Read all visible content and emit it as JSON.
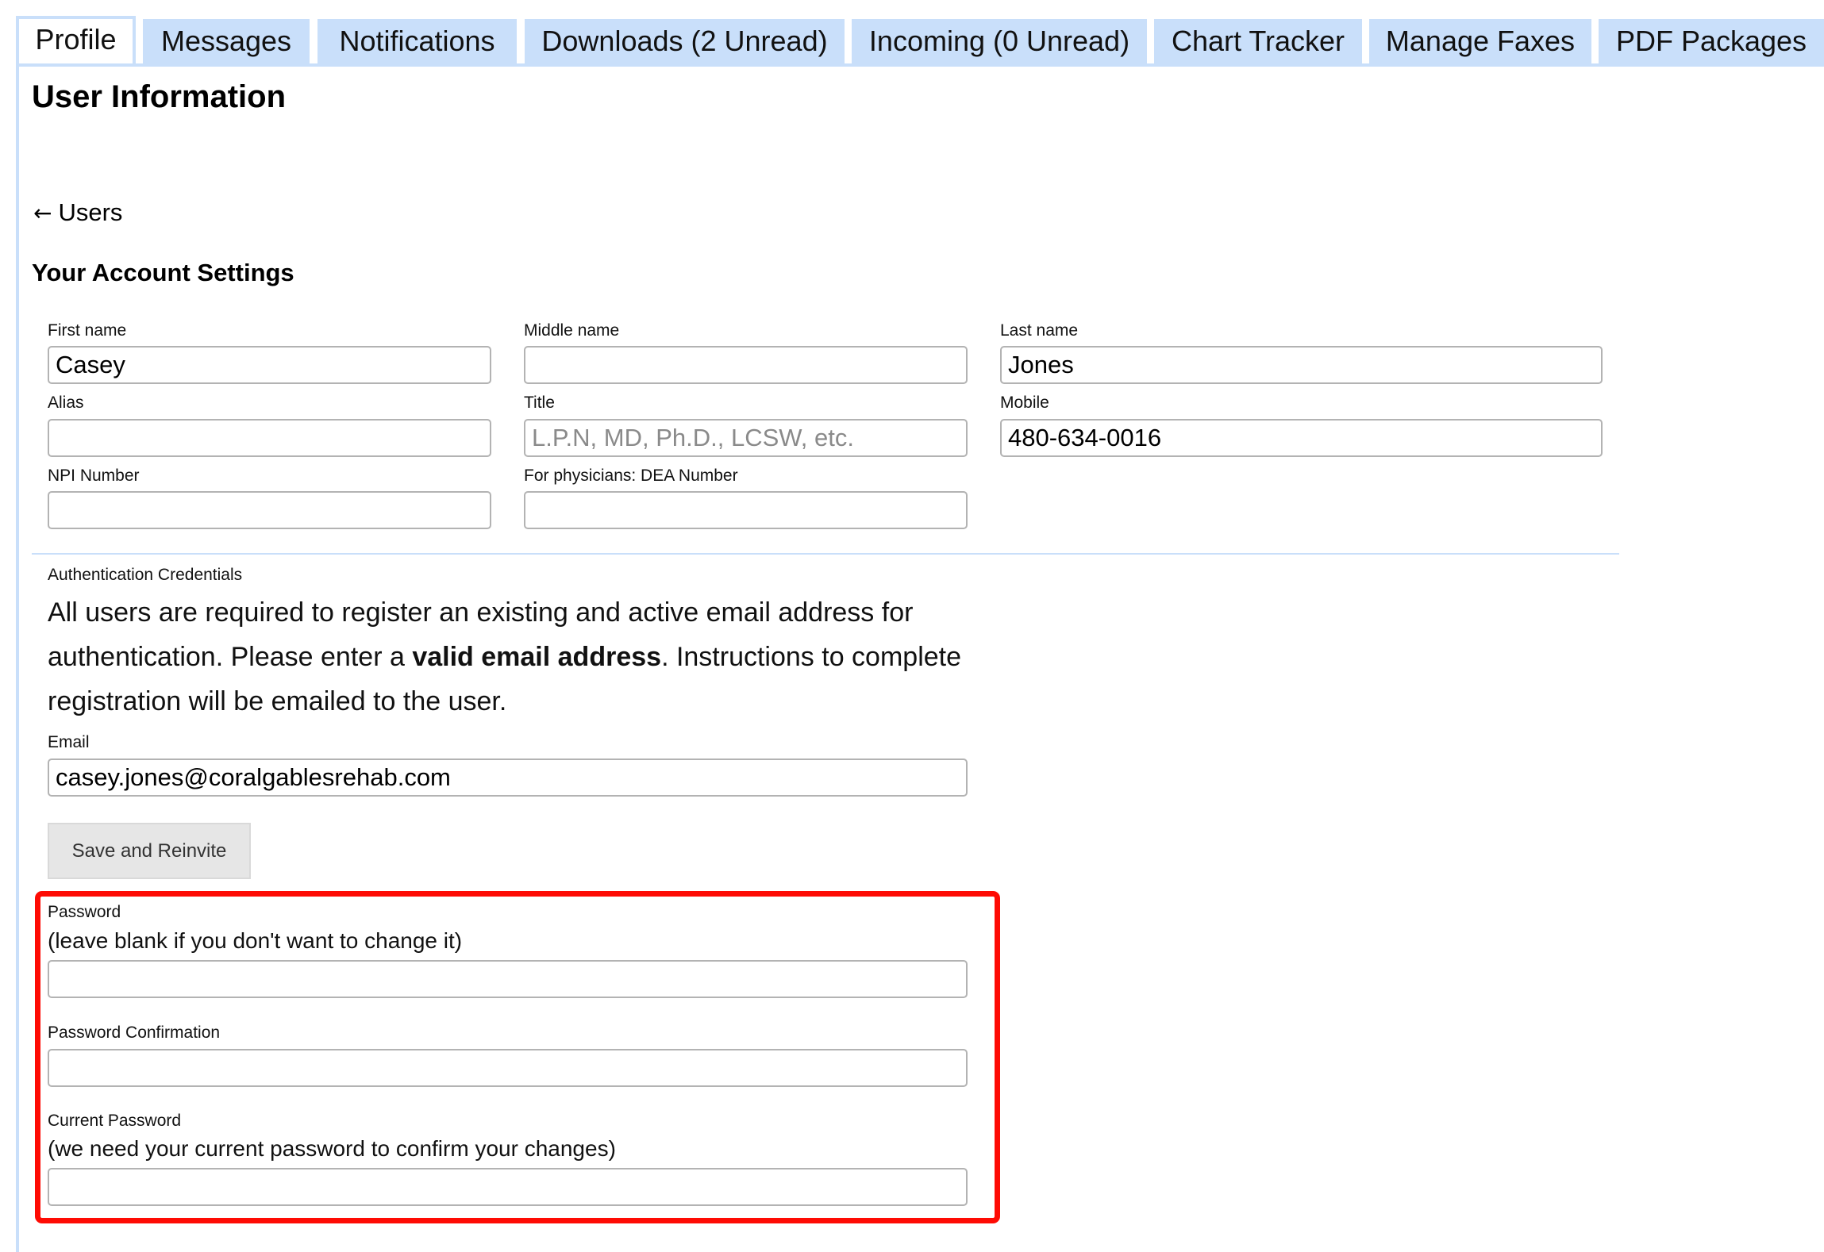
{
  "tabs": [
    {
      "label": "Profile",
      "active": true
    },
    {
      "label": "Messages",
      "active": false
    },
    {
      "label": "Notifications",
      "active": false
    },
    {
      "label": "Downloads (2 Unread)",
      "active": false
    },
    {
      "label": "Incoming (0 Unread)",
      "active": false
    },
    {
      "label": "Chart Tracker",
      "active": false
    },
    {
      "label": "Manage Faxes",
      "active": false
    },
    {
      "label": "PDF Packages",
      "active": false
    }
  ],
  "page": {
    "title": "User Information",
    "back_link": {
      "icon": "arrow-left-icon",
      "arrow": "←",
      "label": "Users"
    },
    "section_title": "Your Account Settings"
  },
  "form": {
    "first_name": {
      "label": "First name",
      "value": "Casey",
      "placeholder": ""
    },
    "middle_name": {
      "label": "Middle name",
      "value": "",
      "placeholder": ""
    },
    "last_name": {
      "label": "Last name",
      "value": "Jones",
      "placeholder": ""
    },
    "alias": {
      "label": "Alias",
      "value": "",
      "placeholder": ""
    },
    "title": {
      "label": "Title",
      "value": "",
      "placeholder": "L.P.N, MD, Ph.D., LCSW, etc."
    },
    "mobile": {
      "label": "Mobile",
      "value": "480-634-0016",
      "placeholder": ""
    },
    "npi": {
      "label": "NPI Number",
      "value": "",
      "placeholder": ""
    },
    "dea": {
      "label": "For physicians: DEA Number",
      "value": "",
      "placeholder": ""
    }
  },
  "auth": {
    "heading": "Authentication Credentials",
    "text_before": "All users are required to register an existing and active email address for authentication. Please enter a ",
    "text_bold": "valid email address",
    "text_after": ". Instructions to complete registration will be emailed to the user.",
    "email": {
      "label": "Email",
      "value": "casey.jones@coralgablesrehab.com"
    },
    "save_reinvite_label": "Save and Reinvite"
  },
  "password": {
    "highlight_color": "#fe0b04",
    "new": {
      "label": "Password",
      "hint": "(leave blank if you don't want to change it)",
      "value": ""
    },
    "confirm": {
      "label": "Password Confirmation",
      "value": ""
    },
    "current": {
      "label": "Current Password",
      "hint": "(we need your current password to confirm your changes)",
      "value": ""
    }
  }
}
